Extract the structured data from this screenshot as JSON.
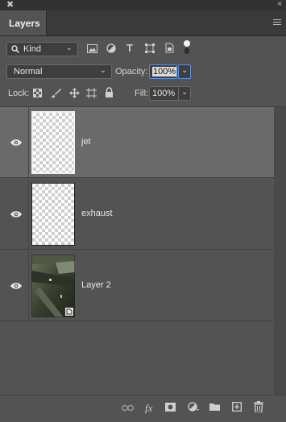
{
  "window": {
    "close_glyph": "✖",
    "collapse_glyph": "‹‹"
  },
  "tab": {
    "title": "Layers"
  },
  "filter": {
    "kind_label": "Kind",
    "kind_icon": "search-icon"
  },
  "blend": {
    "mode": "Normal",
    "opacity_label": "Opacity:",
    "opacity_value": "100%"
  },
  "lock": {
    "label": "Lock:",
    "fill_label": "Fill:",
    "fill_value": "100%"
  },
  "layers": [
    {
      "name": "jet",
      "visible": true,
      "selected": true,
      "type": "transparent"
    },
    {
      "name": "exhaust",
      "visible": true,
      "selected": false,
      "type": "transparent"
    },
    {
      "name": "Layer 2",
      "visible": true,
      "selected": false,
      "type": "image",
      "smart_object": true
    }
  ],
  "footer_icons": [
    "link-icon",
    "fx-icon",
    "mask-icon",
    "adjustment-icon",
    "folder-icon",
    "new-layer-icon",
    "trash-icon"
  ],
  "footer": {
    "fx_label": "fx"
  }
}
